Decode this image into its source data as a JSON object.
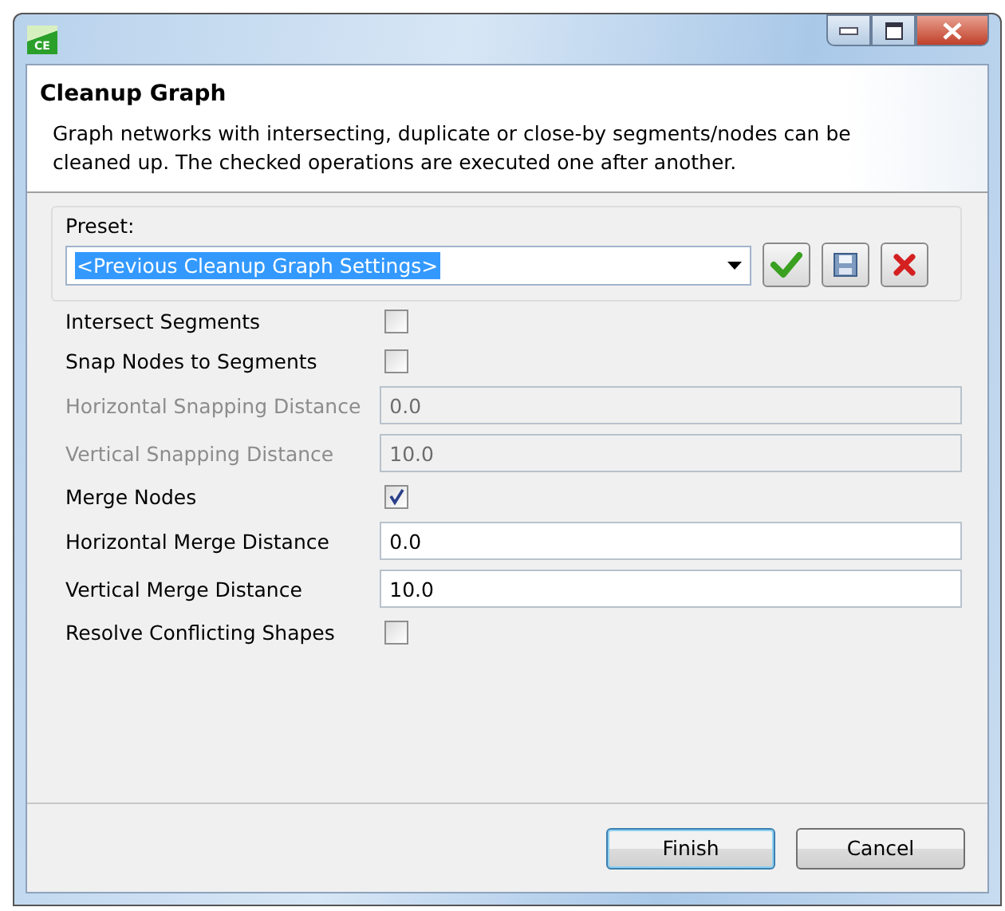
{
  "window": {
    "app_icon_text": "CE"
  },
  "header": {
    "title": "Cleanup Graph",
    "description": "Graph networks with intersecting, duplicate or close-by segments/nodes can be cleaned up. The checked operations are executed one after another."
  },
  "preset": {
    "label": "Preset:",
    "value": "<Previous Cleanup Graph Settings>"
  },
  "options": [
    {
      "kind": "checkbox",
      "label": "Intersect Segments",
      "checked": false,
      "disabled": false
    },
    {
      "kind": "checkbox",
      "label": "Snap Nodes to Segments",
      "checked": false,
      "disabled": false
    },
    {
      "kind": "field",
      "label": "Horizontal Snapping Distance",
      "value": "0.0",
      "disabled": true
    },
    {
      "kind": "field",
      "label": "Vertical Snapping Distance",
      "value": "10.0",
      "disabled": true
    },
    {
      "kind": "checkbox",
      "label": "Merge Nodes",
      "checked": true,
      "disabled": false
    },
    {
      "kind": "field",
      "label": "Horizontal Merge Distance",
      "value": "0.0",
      "disabled": false
    },
    {
      "kind": "field",
      "label": "Vertical Merge Distance",
      "value": "10.0",
      "disabled": false
    },
    {
      "kind": "checkbox",
      "label": "Resolve Conflicting Shapes",
      "checked": false,
      "disabled": false
    }
  ],
  "buttons": [
    {
      "label": "Finish",
      "default": true
    },
    {
      "label": "Cancel",
      "default": false
    }
  ]
}
